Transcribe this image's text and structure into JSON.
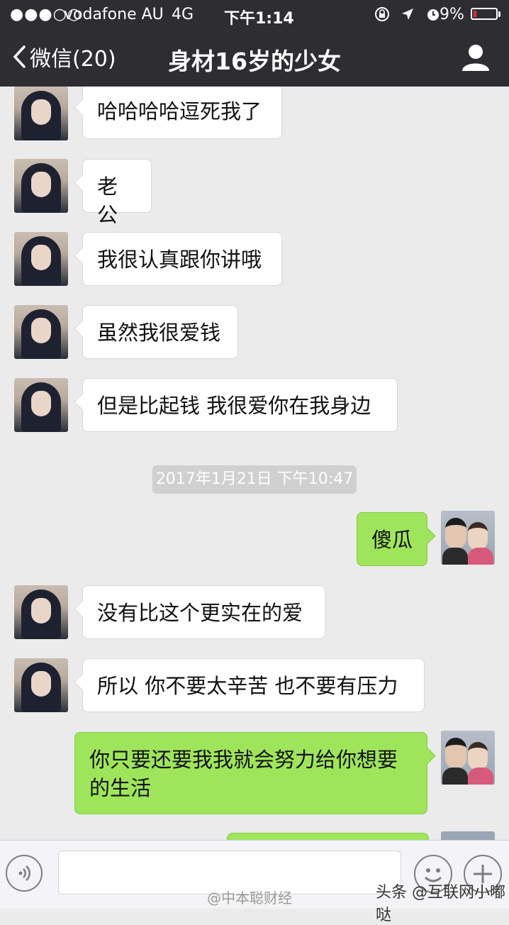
{
  "status_bar": {
    "signal": "●●●○○",
    "carrier": "vodafone AU",
    "network": "4G",
    "time": "下午1:14",
    "battery": "9%",
    "battery_level": 0.09
  },
  "nav": {
    "back_label": "微信(20)",
    "title": "身材16岁的少女"
  },
  "messages": [
    {
      "from": "her",
      "text": "哈哈哈哈逗死我了"
    },
    {
      "from": "her",
      "text": "老公"
    },
    {
      "from": "her",
      "text": "我很认真跟你讲哦"
    },
    {
      "from": "her",
      "text": "虽然我很爱钱"
    },
    {
      "from": "her",
      "text": "但是比起钱 我很爱你在我身边"
    },
    {
      "from": "me",
      "text": "傻瓜"
    },
    {
      "from": "her",
      "text": "没有比这个更实在的爱"
    },
    {
      "from": "her",
      "text": "所以 你不要太辛苦 也不要有压力"
    },
    {
      "from": "me",
      "text": "你只要还要我我就会努力给你想要的生活"
    }
  ],
  "timestamp": "2017年1月21日 下午10:47",
  "watermarks": {
    "weibo": "@中本聪财经",
    "toutiao": "头条 @互联网小嘟哒"
  },
  "colors": {
    "header_bg": "#2e2e32",
    "chat_bg": "#ebebeb",
    "incoming_bubble": "#ffffff",
    "outgoing_bubble": "#9fe55b"
  },
  "icons": {
    "back": "chevron-left-icon",
    "profile": "person-icon",
    "voice": "voice-icon",
    "emoji": "emoji-icon",
    "plus": "plus-icon"
  }
}
